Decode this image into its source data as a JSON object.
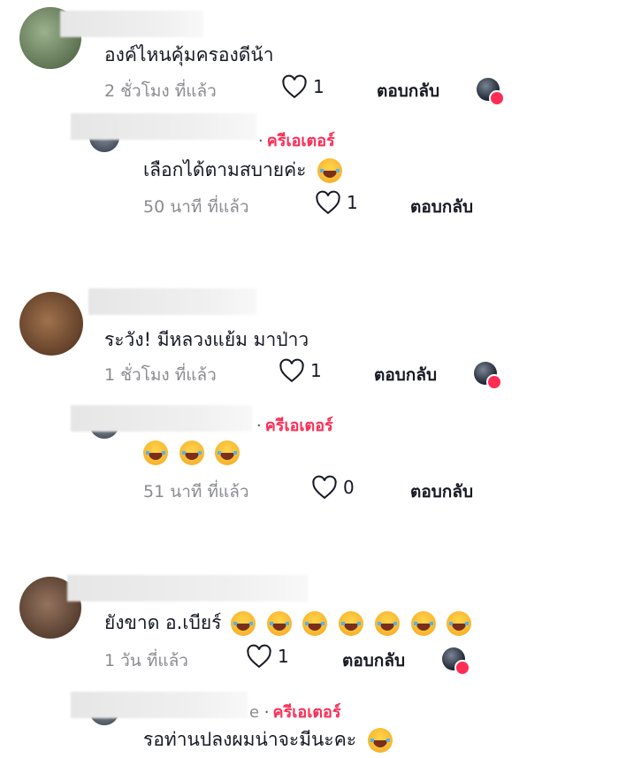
{
  "threads": [
    {
      "comment": {
        "text": "องค์ไหนคุ้มครองดีน้า",
        "time": "2 ชั่วโมง ที่แล้ว",
        "likes": "1",
        "reply_label": "ตอบกลับ"
      },
      "reply": {
        "creator_tag": "ครีเอเตอร์",
        "text": "เลือกได้ตามสบายค่ะ",
        "emoji_count": 1,
        "time": "50 นาที ที่แล้ว",
        "likes": "1",
        "reply_label": "ตอบกลับ"
      }
    },
    {
      "comment": {
        "text": "ระวัง! มีหลวงแย้ม มาป่าว",
        "time": "1 ชั่วโมง ที่แล้ว",
        "likes": "1",
        "reply_label": "ตอบกลับ"
      },
      "reply": {
        "creator_tag": "ครีเอเตอร์",
        "text": "",
        "emoji_count": 3,
        "time": "51 นาที ที่แล้ว",
        "likes": "0",
        "reply_label": "ตอบกลับ"
      }
    },
    {
      "comment": {
        "text": "ยังขาด อ.เบียร์",
        "emoji_count": 7,
        "time": "1 วัน ที่แล้ว",
        "likes": "1",
        "reply_label": "ตอบกลับ"
      },
      "reply": {
        "creator_tag": "ครีเอเตอร์",
        "name_fragment": "e",
        "text": "รอท่านปลงผมน่าจะมีนะคะ",
        "emoji_count": 1
      }
    }
  ],
  "colors": {
    "accent": "#fe2c55",
    "meta": "#8a8b91",
    "text": "#161823"
  },
  "icons": {
    "like": "heart-outline-icon",
    "emoji": "laughing-tears-emoji-icon"
  }
}
